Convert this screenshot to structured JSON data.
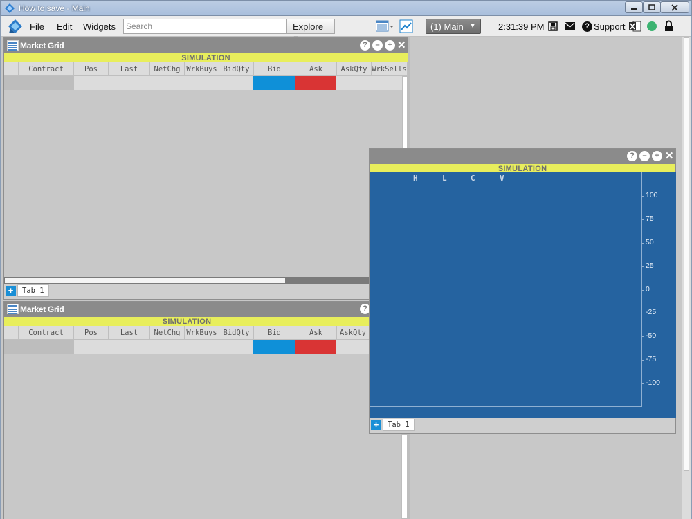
{
  "window": {
    "title": "How to save - Main"
  },
  "menubar": {
    "file": "File",
    "edit": "Edit",
    "widgets": "Widgets",
    "search_placeholder": "Search",
    "explore": "Explore",
    "workspace_select": "(1) Main",
    "clock": "2:31:39 PM",
    "support": "Support"
  },
  "grid_top": {
    "title": "Market Grid",
    "mode": "SIMULATION",
    "columns": [
      "",
      "Contract",
      "Pos",
      "Last",
      "NetChg",
      "WrkBuys",
      "BidQty",
      "Bid",
      "Ask",
      "AskQty",
      "WrkSells"
    ],
    "tab": "Tab 1"
  },
  "grid_bottom": {
    "title": "Market Grid",
    "mode": "SIMULATION",
    "columns": [
      "",
      "Contract",
      "Pos",
      "Last",
      "NetChg",
      "WrkBuys",
      "BidQty",
      "Bid",
      "Ask",
      "AskQty"
    ]
  },
  "chart_window": {
    "mode": "SIMULATION",
    "ohlc_labels": [
      "H",
      "L",
      "C",
      "V"
    ],
    "tab": "Tab 1"
  },
  "chart_data": {
    "type": "line",
    "title": "",
    "series": [],
    "yticks": [
      100,
      75,
      50,
      25,
      0,
      -25,
      -50,
      -75,
      -100
    ],
    "ylim": [
      -125,
      125
    ],
    "grid": false
  },
  "colors": {
    "bid": "#0f90d8",
    "ask": "#d93434",
    "simulation_banner": "#e8ee5c",
    "chart_background": "#2563a0"
  }
}
